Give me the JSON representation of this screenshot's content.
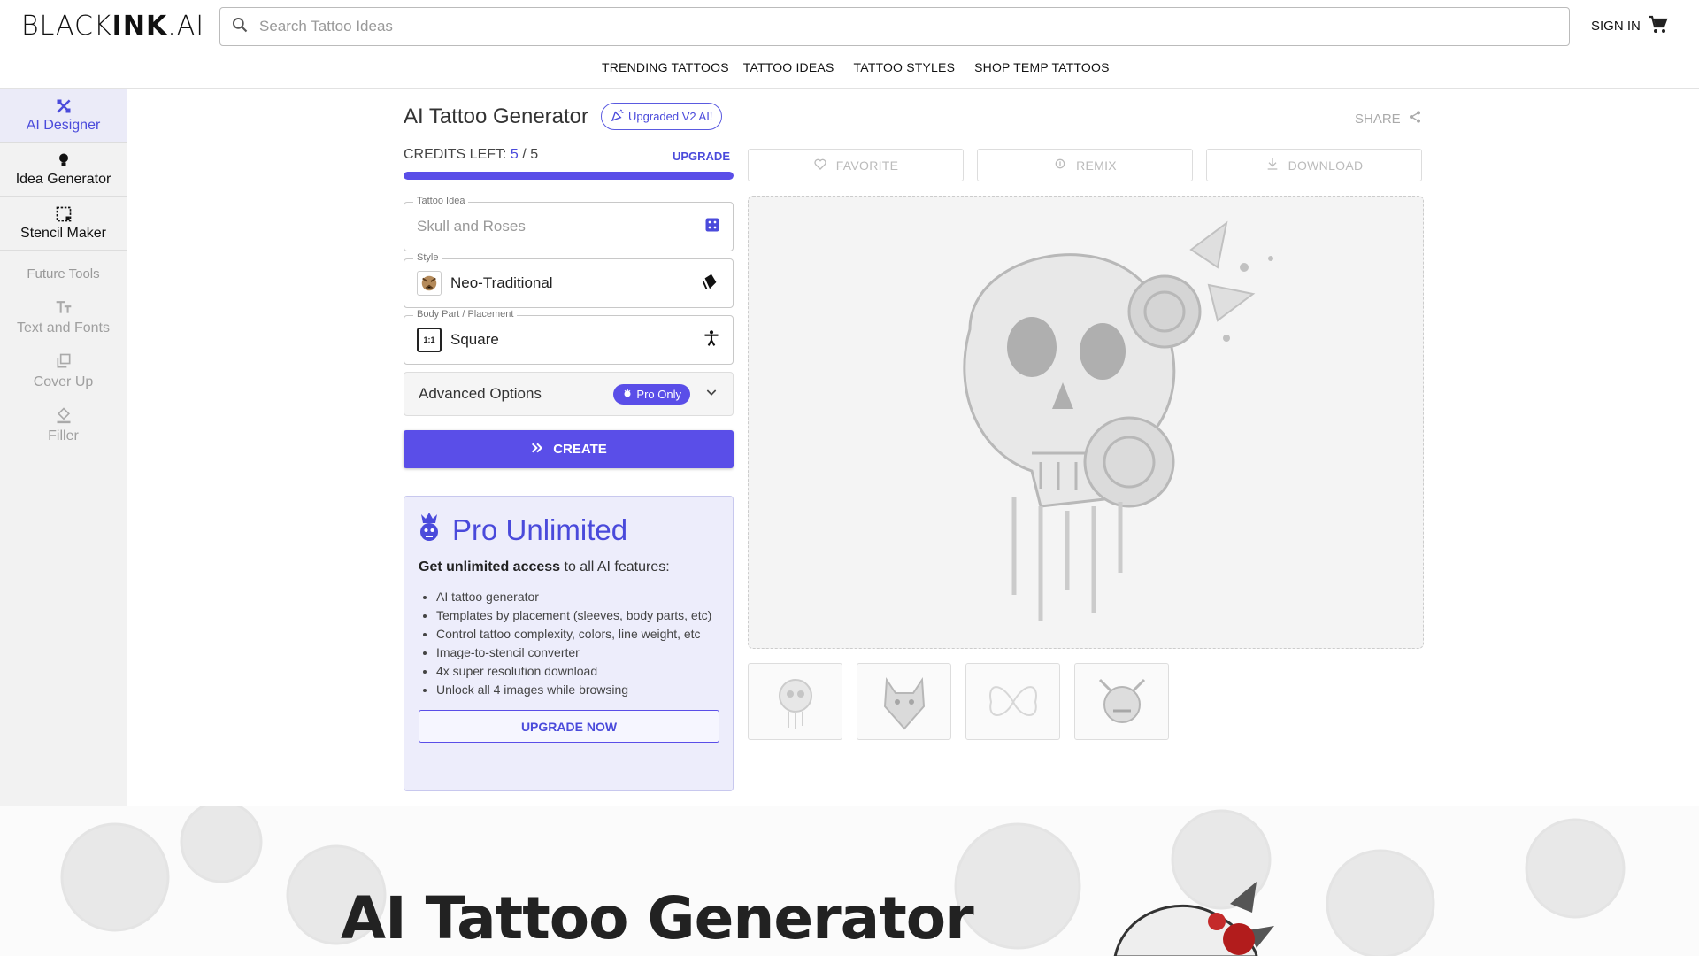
{
  "header": {
    "logo_light": "BLACK",
    "logo_bold": "INK",
    "logo_tail": ".AI",
    "search_placeholder": "Search Tattoo Ideas",
    "signin": "SIGN IN",
    "nav": [
      "TRENDING TATTOOS",
      "TATTOO IDEAS",
      "TATTOO STYLES",
      "SHOP TEMP TATTOOS"
    ]
  },
  "sidebar": {
    "items": [
      {
        "label": "AI Designer",
        "icon": "pencil-ruler-icon"
      },
      {
        "label": "Idea Generator",
        "icon": "lightbulb-icon"
      },
      {
        "label": "Stencil Maker",
        "icon": "stencil-icon"
      }
    ],
    "future_label": "Future Tools",
    "future": [
      {
        "label": "Text and Fonts",
        "icon": "text-icon"
      },
      {
        "label": "Cover Up",
        "icon": "layers-icon"
      },
      {
        "label": "Filler",
        "icon": "paint-bucket-icon"
      }
    ]
  },
  "main": {
    "title": "AI Tattoo Generator",
    "badge": "Upgraded V2 AI!",
    "share": "SHARE",
    "credits_label": "CREDITS LEFT:",
    "credits_used": "5",
    "credits_sep": "/",
    "credits_total": "5",
    "credits_fraction": 1.0,
    "upgrade": "UPGRADE",
    "idea_legend": "Tattoo Idea",
    "idea_placeholder": "Skull and Roses",
    "style_legend": "Style",
    "style_value": "Neo-Traditional",
    "placement_legend": "Body Part / Placement",
    "placement_value": "Square",
    "placement_ratio": "1:1",
    "advanced": "Advanced Options",
    "pro_only": "Pro Only",
    "create": "CREATE",
    "accent": "#5a4ee8"
  },
  "pro": {
    "title": "Pro Unlimited",
    "sub_bold": "Get unlimited access",
    "sub_rest": " to all AI features:",
    "features": [
      "AI tattoo generator",
      "Templates by placement (sleeves, body parts, etc)",
      "Control tattoo complexity, colors, line weight, etc",
      "Image-to-stencil converter",
      "4x super resolution download",
      "Unlock all 4 images while browsing"
    ],
    "button": "UPGRADE NOW"
  },
  "actions": [
    "FAVORITE",
    "REMIX",
    "DOWNLOAD"
  ],
  "hero": {
    "title": "AI Tattoo Generator"
  }
}
